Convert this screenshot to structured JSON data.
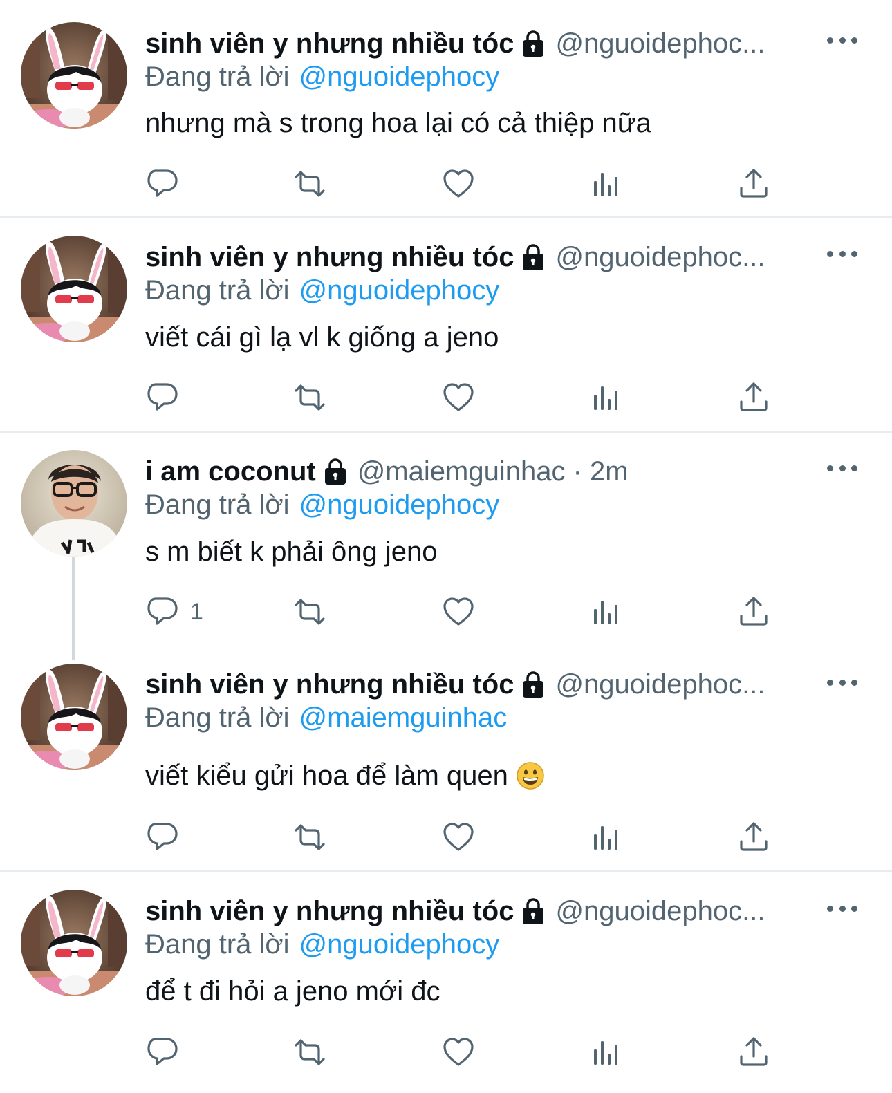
{
  "tweets": [
    {
      "display_name": "sinh viên y nhưng nhiều tóc",
      "handle": "@nguoidephoc...",
      "reply_prefix": "Đang trả lời",
      "reply_to": "@nguoidephocy",
      "text": "nhưng mà s trong hoa lại có cả thiệp nữa",
      "reply_count": ""
    },
    {
      "display_name": "sinh viên y nhưng nhiều tóc",
      "handle": "@nguoidephoc...",
      "reply_prefix": "Đang trả lời",
      "reply_to": "@nguoidephocy",
      "text": "viết cái gì lạ vl k giống a jeno",
      "reply_count": ""
    },
    {
      "display_name": "i am coconut",
      "handle": "@maiemguinhac · 2m",
      "reply_prefix": "Đang trả lời",
      "reply_to": "@nguoidephocy",
      "text": "s m biết k phải ông jeno",
      "reply_count": "1"
    },
    {
      "display_name": "sinh viên y nhưng nhiều tóc",
      "handle": "@nguoidephoc...",
      "reply_prefix": "Đang trả lời",
      "reply_to": "@maiemguinhac",
      "text": "viết kiểu gửi hoa để làm quen",
      "emoji": "grinning-face",
      "reply_count": ""
    },
    {
      "display_name": "sinh viên y nhưng nhiều tóc",
      "handle": "@nguoidephoc...",
      "reply_prefix": "Đang trả lời",
      "reply_to": "@nguoidephocy",
      "text": "để t đi hỏi a jeno mới đc",
      "reply_count": ""
    }
  ],
  "icons": {
    "reply": "reply-icon",
    "retweet": "retweet-icon",
    "like": "heart-icon",
    "analytics": "analytics-icon",
    "share": "share-icon",
    "lock": "lock-icon",
    "more": "more-icon"
  },
  "colors": {
    "text": "#0f1419",
    "secondary": "#536471",
    "link": "#1d9bf0",
    "divider": "#e6ecf0"
  }
}
